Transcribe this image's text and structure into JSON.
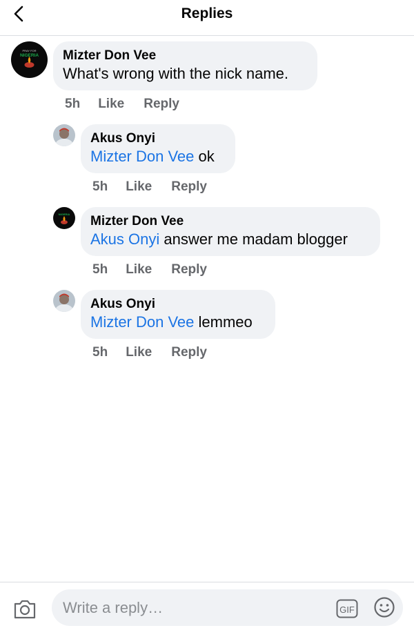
{
  "header": {
    "title": "Replies"
  },
  "comments": [
    {
      "author": "Mizter Don Vee",
      "mention": "",
      "text": "What's wrong with the nick name.",
      "time": "5h",
      "like": "Like",
      "reply": "Reply",
      "avatar_text_top": "PRAY FOR",
      "avatar_text_main": "NIGERIA"
    },
    {
      "author": "Akus Onyi",
      "mention": "Mizter Don Vee",
      "text": " ok",
      "time": "5h",
      "like": "Like",
      "reply": "Reply"
    },
    {
      "author": "Mizter Don Vee",
      "mention": "Akus Onyi",
      "text": " answer me madam blogger",
      "time": "5h",
      "like": "Like",
      "reply": "Reply",
      "avatar_text_main": "NIGERIA"
    },
    {
      "author": "Akus Onyi",
      "mention": "Mizter Don Vee",
      "text": " lemmeo",
      "time": "5h",
      "like": "Like",
      "reply": "Reply"
    }
  ],
  "composer": {
    "placeholder": "Write a reply…",
    "gif_label": "GIF"
  }
}
